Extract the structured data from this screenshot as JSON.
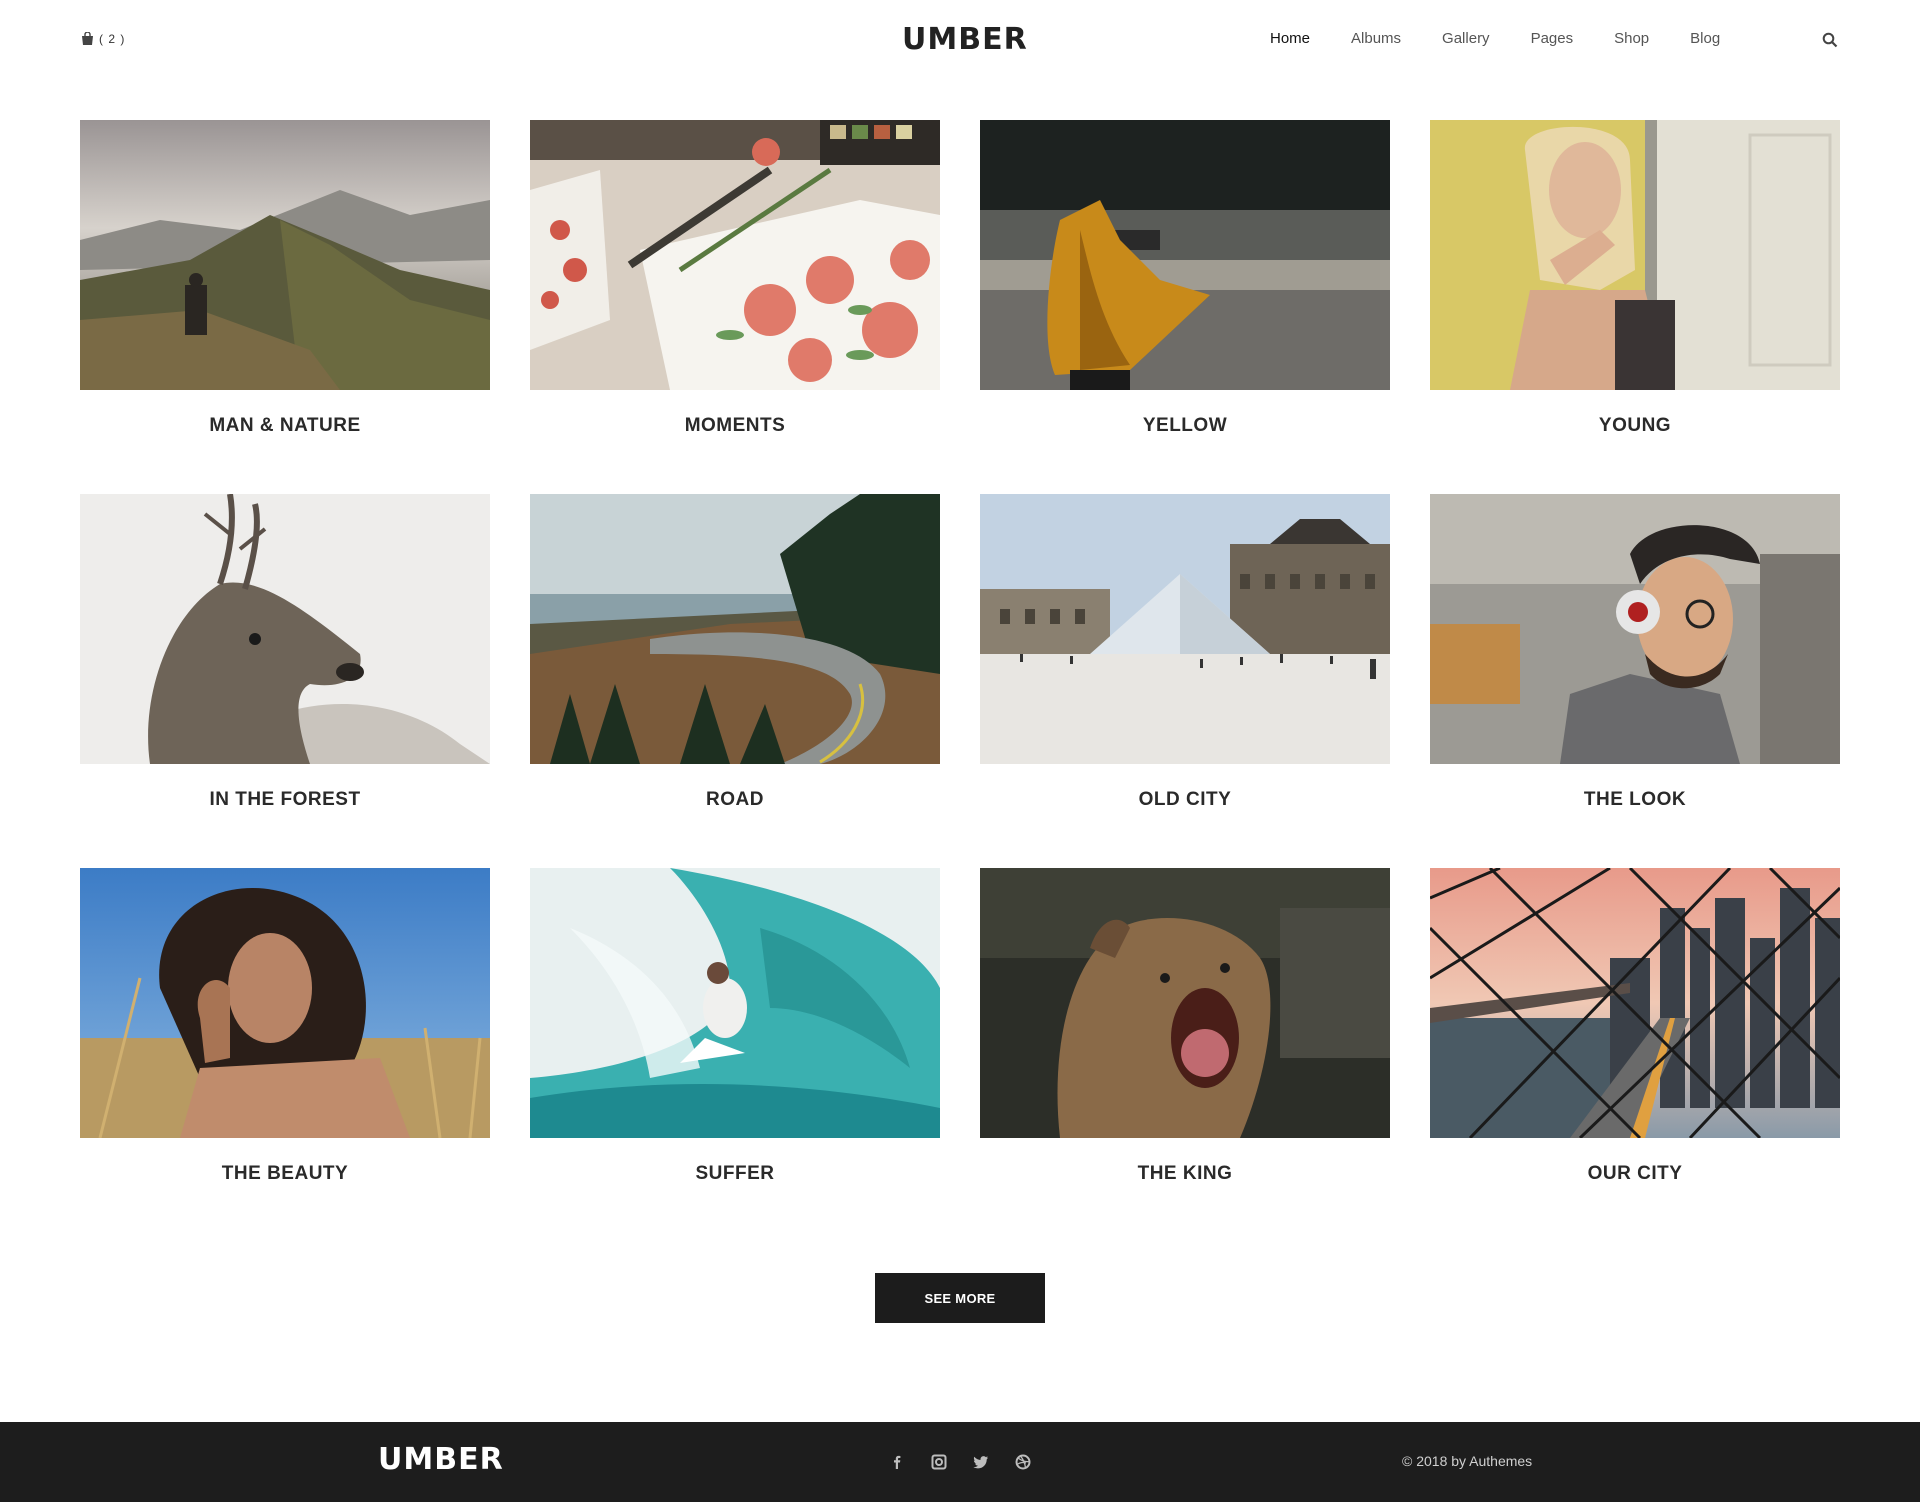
{
  "header": {
    "cart_count": "( 2 )",
    "logo": "UMBER",
    "nav": [
      "Home",
      "Albums",
      "Gallery",
      "Pages",
      "Shop",
      "Blog"
    ]
  },
  "albums": [
    {
      "title": "MAN & NATURE"
    },
    {
      "title": "MOMENTS"
    },
    {
      "title": "YELLOW"
    },
    {
      "title": "YOUNG"
    },
    {
      "title": "IN THE FOREST"
    },
    {
      "title": "ROAD"
    },
    {
      "title": "OLD CITY"
    },
    {
      "title": "THE LOOK"
    },
    {
      "title": "THE BEAUTY"
    },
    {
      "title": "SUFFER"
    },
    {
      "title": "THE KING"
    },
    {
      "title": "OUR CITY"
    }
  ],
  "see_more_label": "SEE MORE",
  "footer": {
    "logo": "UMBER",
    "copyright": "© 2018 by Authemes",
    "social": [
      "facebook-icon",
      "instagram-icon",
      "twitter-icon",
      "dribbble-icon"
    ]
  },
  "colors": {
    "accent": "#1c1c1c",
    "footer_bg": "#1d1d1d"
  }
}
